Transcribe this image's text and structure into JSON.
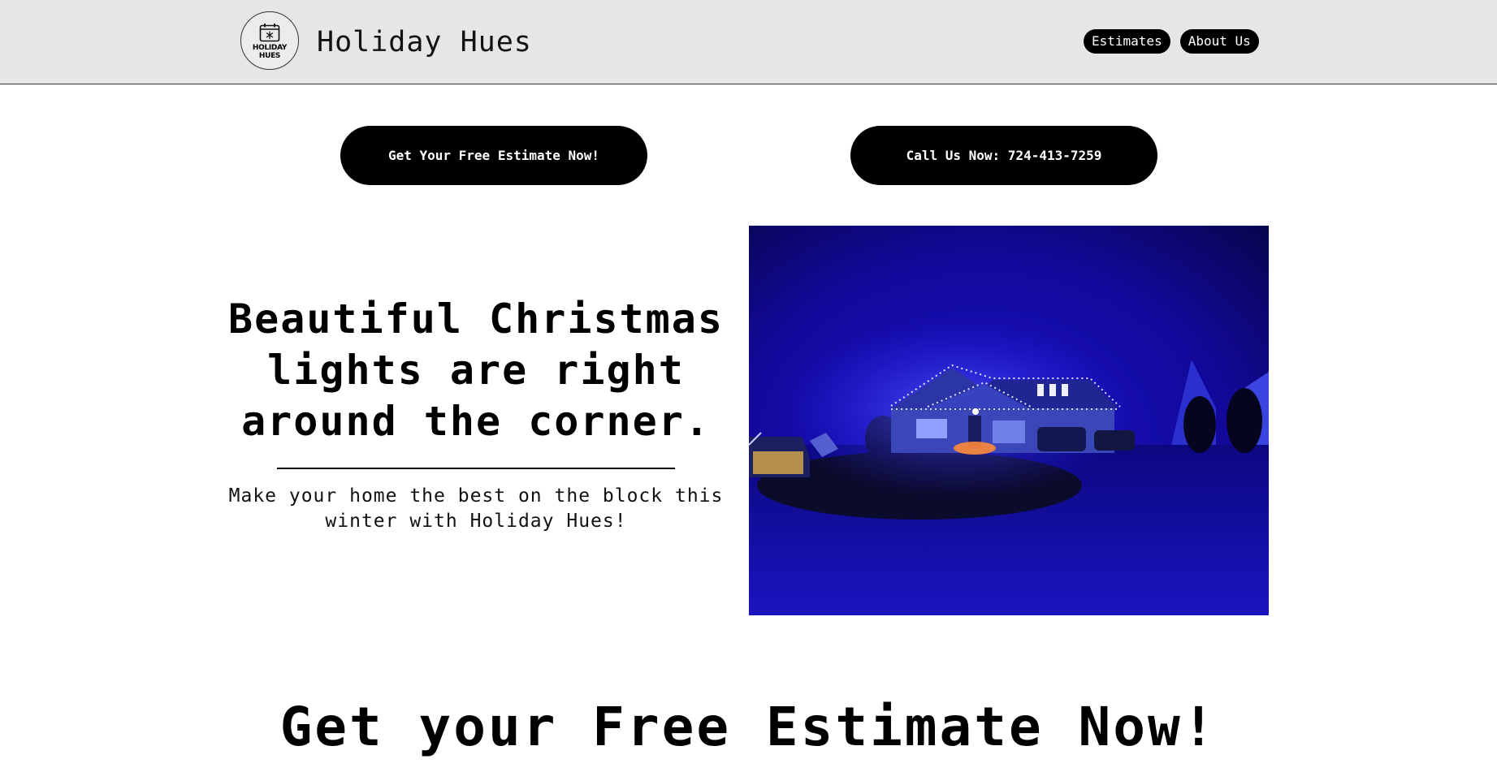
{
  "header": {
    "logo_text_line1": "HOLIDAY",
    "logo_text_line2": "HUES",
    "brand": "Holiday Hues",
    "nav": [
      "Estimates",
      "About Us"
    ]
  },
  "cta": {
    "estimate": "Get Your Free Estimate Now!",
    "call": "Call Us Now: 724-413-7259"
  },
  "hero": {
    "heading": "Beautiful Christmas lights are right around the corner.",
    "subtext": "Make your home the best on the block this winter with Holiday Hues!",
    "photo_icon": "house-with-blue-christmas-lights-photo"
  },
  "section": {
    "title": "Get your Free Estimate Now!"
  },
  "colors": {
    "header_bg": "#e6e6e6",
    "button_bg": "#000000",
    "button_text": "#ffffff",
    "photo_tint": "#1a0fd8"
  }
}
